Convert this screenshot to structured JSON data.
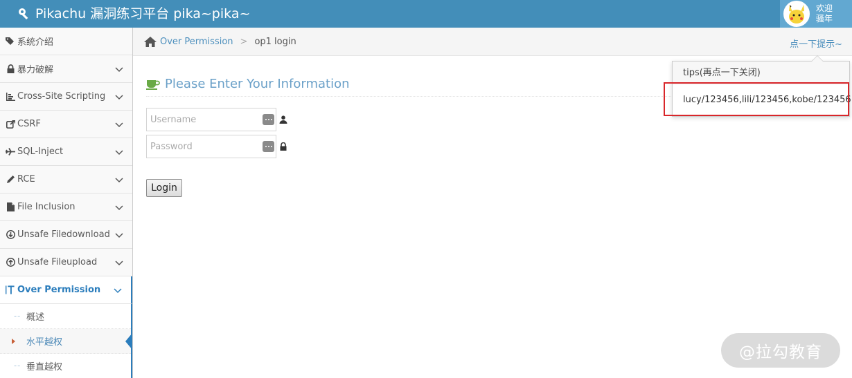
{
  "header": {
    "brand": "Pikachu 漏洞练习平台 pika~pika~",
    "user_line1": "欢迎",
    "user_line2": "骚年"
  },
  "sidebar": {
    "items": [
      {
        "label": "系统介绍",
        "icon": "tags-icon"
      },
      {
        "label": "暴力破解",
        "icon": "lock-icon"
      },
      {
        "label": "Cross-Site Scripting",
        "icon": "bar-chart-icon"
      },
      {
        "label": "CSRF",
        "icon": "share-icon"
      },
      {
        "label": "SQL-Inject",
        "icon": "plane-icon"
      },
      {
        "label": "RCE",
        "icon": "pencil-icon"
      },
      {
        "label": "File Inclusion",
        "icon": "file-icon"
      },
      {
        "label": "Unsafe Filedownload",
        "icon": "download-circle-icon"
      },
      {
        "label": "Unsafe Fileupload",
        "icon": "upload-circle-icon"
      },
      {
        "label": "Over Permission",
        "icon": "text-cursor-icon"
      }
    ],
    "subitems": [
      {
        "label": "概述"
      },
      {
        "label": "水平越权"
      },
      {
        "label": "垂直越权"
      }
    ]
  },
  "breadcrumb": {
    "parent": "Over Permission",
    "separator": ">",
    "current": "op1 login",
    "tips_link": "点一下提示~"
  },
  "form": {
    "title": "Please Enter Your Information",
    "username_placeholder": "Username",
    "password_placeholder": "Password",
    "login_label": "Login"
  },
  "popover": {
    "title": "tips(再点一下关闭)",
    "body": "lucy/123456,lili/123456,kobe/123456"
  },
  "watermark": "@拉勾教育",
  "colors": {
    "navbar": "#438eb9",
    "accent": "#2b7dbc",
    "highlight": "#d9262a"
  }
}
